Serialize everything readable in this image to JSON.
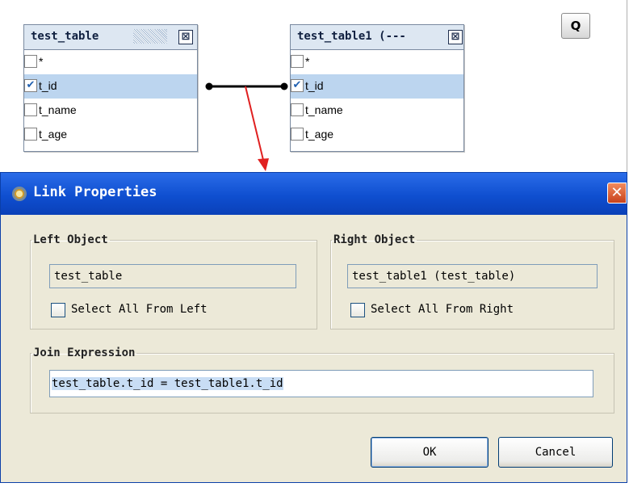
{
  "canvas": {
    "left_table": {
      "title": "test_table",
      "close_glyph": "⊠",
      "fields": [
        {
          "label": "*",
          "checked": false
        },
        {
          "label": "t_id",
          "checked": true
        },
        {
          "label": "t_name",
          "checked": false
        },
        {
          "label": "t_age",
          "checked": false
        }
      ]
    },
    "right_table": {
      "title": "test_table1 (---",
      "close_glyph": "⊠",
      "fields": [
        {
          "label": "*",
          "checked": false
        },
        {
          "label": "t_id",
          "checked": true
        },
        {
          "label": "t_name",
          "checked": false
        },
        {
          "label": "t_age",
          "checked": false
        }
      ]
    },
    "q_button": "Q",
    "check_glyph": "✔"
  },
  "dialog": {
    "title": "Link Properties",
    "close_glyph": "✕",
    "left_group": {
      "legend": "Left Object",
      "value": "test_table",
      "checkbox_label": "Select All From Left"
    },
    "right_group": {
      "legend": "Right Object",
      "value": "test_table1 (test_table)",
      "checkbox_label": "Select All From Right"
    },
    "join_group": {
      "legend": "Join Expression",
      "value": "test_table.t_id = test_table1.t_id"
    },
    "ok_label": "OK",
    "cancel_label": "Cancel"
  },
  "colors": {
    "titlebar": "#0f4fd0",
    "selection": "#bcd5ef",
    "arrow": "#e02020",
    "dialog_bg": "#ece9d8"
  }
}
